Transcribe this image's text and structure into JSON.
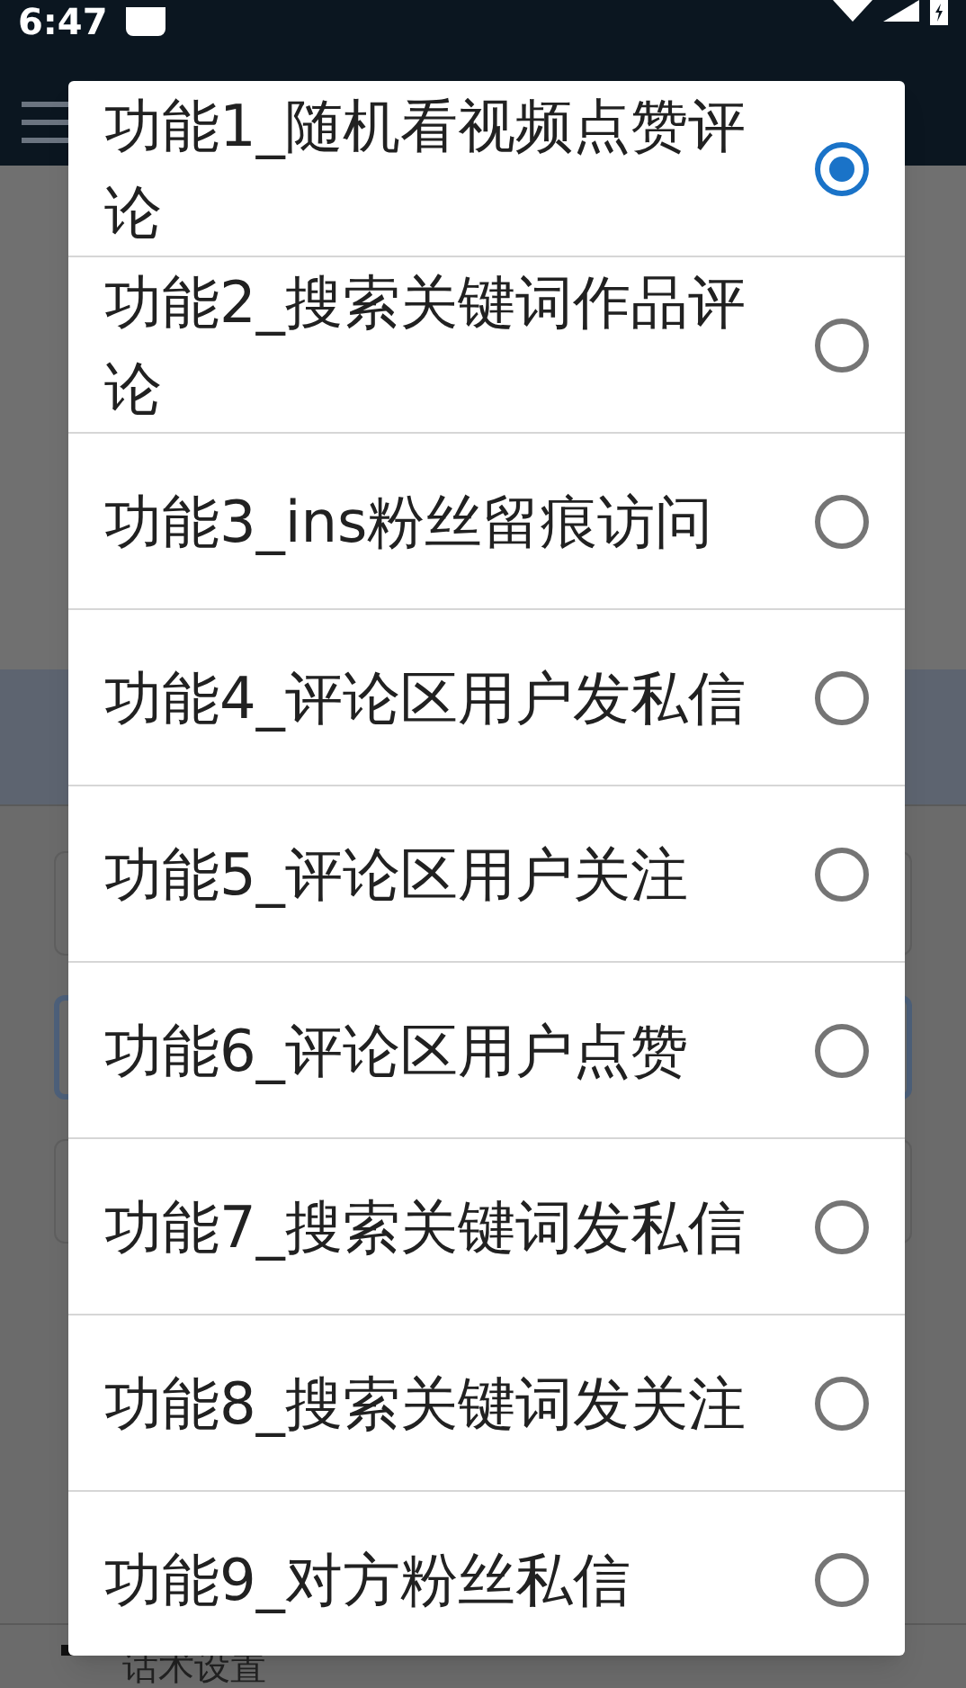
{
  "status_bar": {
    "time": "6:47"
  },
  "background": {
    "bottom_label": "话术设置"
  },
  "dialog": {
    "options": [
      {
        "label": "功能1_随机看视频点赞评论",
        "selected": true
      },
      {
        "label": "功能2_搜索关键词作品评论",
        "selected": false
      },
      {
        "label": "功能3_ins粉丝留痕访问",
        "selected": false
      },
      {
        "label": "功能4_评论区用户发私信",
        "selected": false
      },
      {
        "label": "功能5_评论区用户关注",
        "selected": false
      },
      {
        "label": "功能6_评论区用户点赞",
        "selected": false
      },
      {
        "label": "功能7_搜索关键词发私信",
        "selected": false
      },
      {
        "label": "功能8_搜索关键词发关注",
        "selected": false
      },
      {
        "label": "功能9_对方粉丝私信",
        "selected": false
      }
    ]
  }
}
